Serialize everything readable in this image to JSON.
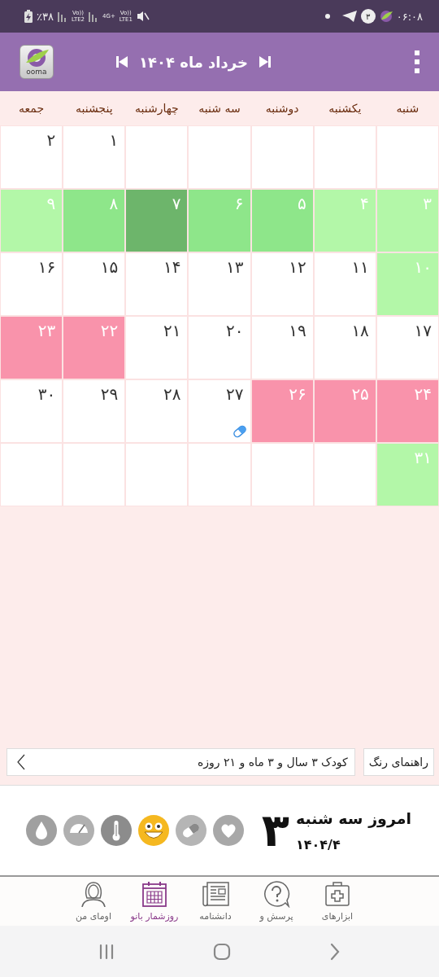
{
  "status_bar": {
    "time": "۰۶:۰۸",
    "notification_count": "۳",
    "battery": "٪۳۸",
    "sim2_label": "LTE2",
    "sim2_volte": "Vo))",
    "sim1_network": "4G+",
    "sim1_volte": "Vo))",
    "sim1_label": "LTE1"
  },
  "header": {
    "title": "خرداد ماه ۱۴۰۴",
    "logo_text": "ooma"
  },
  "weekdays": [
    "شنبه",
    "یکشنبه",
    "دوشنبه",
    "سه شنبه",
    "چهارشنبه",
    "پنجشنبه",
    "جمعه"
  ],
  "days": [
    {
      "color": "#ffffff"
    },
    {
      "color": "#ffffff"
    },
    {
      "color": "#ffffff"
    },
    {
      "color": "#ffffff"
    },
    {
      "color": "#ffffff"
    },
    {
      "day": "۱",
      "color": "#ffffff",
      "pill": false
    },
    {
      "day": "۲",
      "color": "#ffffff",
      "pill": false
    },
    {
      "day": "۳",
      "color": "#b3f7a8",
      "pill": false
    },
    {
      "day": "۴",
      "color": "#b3f7a8",
      "pill": false
    },
    {
      "day": "۵",
      "color": "#8ee68a",
      "pill": false
    },
    {
      "day": "۶",
      "color": "#8ee68a",
      "pill": false
    },
    {
      "day": "۷",
      "color": "#6db56b",
      "pill": false
    },
    {
      "day": "۸",
      "color": "#8ee68a",
      "pill": false
    },
    {
      "day": "۹",
      "color": "#b3f7a8",
      "pill": false
    },
    {
      "day": "۱۰",
      "color": "#b3f7a8",
      "pill": false
    },
    {
      "day": "۱۱",
      "color": "#ffffff",
      "pill": false
    },
    {
      "day": "۱۲",
      "color": "#ffffff",
      "pill": false
    },
    {
      "day": "۱۳",
      "color": "#ffffff",
      "pill": false
    },
    {
      "day": "۱۴",
      "color": "#ffffff",
      "pill": false
    },
    {
      "day": "۱۵",
      "color": "#ffffff",
      "pill": false
    },
    {
      "day": "۱۶",
      "color": "#ffffff",
      "pill": false
    },
    {
      "day": "۱۷",
      "color": "#ffffff",
      "pill": false
    },
    {
      "day": "۱۸",
      "color": "#ffffff",
      "pill": false
    },
    {
      "day": "۱۹",
      "color": "#ffffff",
      "pill": false
    },
    {
      "day": "۲۰",
      "color": "#ffffff",
      "pill": false
    },
    {
      "day": "۲۱",
      "color": "#ffffff",
      "pill": false
    },
    {
      "day": "۲۲",
      "color": "#f993ab",
      "pill": false
    },
    {
      "day": "۲۳",
      "color": "#f993ab",
      "pill": false
    },
    {
      "day": "۲۴",
      "color": "#f993ab",
      "pill": false
    },
    {
      "day": "۲۵",
      "color": "#f993ab",
      "pill": false
    },
    {
      "day": "۲۶",
      "color": "#f993ab",
      "pill": false
    },
    {
      "day": "۲۷",
      "color": "#ffffff",
      "pill": true
    },
    {
      "day": "۲۸",
      "color": "#ffffff",
      "pill": false
    },
    {
      "day": "۲۹",
      "color": "#ffffff",
      "pill": false
    },
    {
      "day": "۳۰",
      "color": "#ffffff",
      "pill": false
    },
    {
      "day": "۳۱",
      "color": "#b3f7a8",
      "pill": false
    },
    {
      "color": "#ffffff"
    },
    {
      "color": "#ffffff"
    },
    {
      "color": "#ffffff"
    },
    {
      "color": "#ffffff"
    },
    {
      "color": "#ffffff"
    },
    {
      "color": "#ffffff"
    }
  ],
  "child_age": "کودک ۳ سال و ۳ ماه و ۲۱ روزه",
  "color_guide_button": "راهنمای رنگ",
  "today": {
    "day": "۳",
    "label": "امروز سه شنبه",
    "date": "۱۴۰۴/۴"
  },
  "bottom_nav": [
    {
      "label": "ابزارهای",
      "selected": false
    },
    {
      "label": "پرسش و",
      "selected": false
    },
    {
      "label": "دانشنامه",
      "selected": false
    },
    {
      "label": "روزشمار بانو",
      "selected": true
    },
    {
      "label": "اومای من",
      "selected": false
    }
  ]
}
